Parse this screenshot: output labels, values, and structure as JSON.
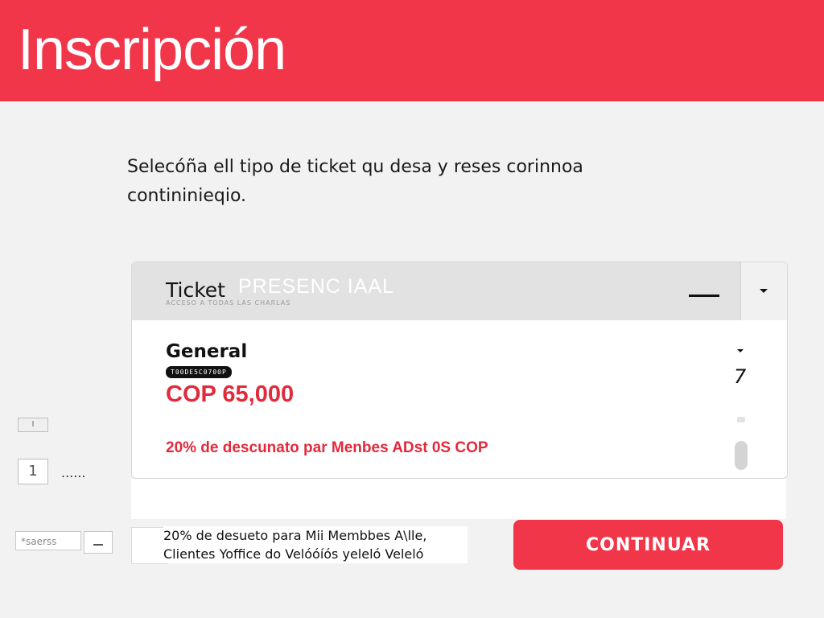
{
  "header": {
    "title": "Inscripción"
  },
  "instructions": {
    "line1": "Selecóña ell tipo de ticket qu desa y reses corinnoa",
    "line2": "contininieqio."
  },
  "ticket_selector": {
    "label": "Ticket",
    "type": "PRESENC IAAL",
    "subtext": "ACCESO A TODAS LAS CHARLAS",
    "dropdown_icon": "caret-down-icon"
  },
  "plan": {
    "name": "General",
    "code": "T00DE5C0700P",
    "price": "COP 65,000",
    "discount": "20% de descunato par Menbes ADst 0S COP",
    "quantity": "7"
  },
  "left_panel": {
    "box1_value": "I",
    "box2_value": "1",
    "dots": "......",
    "search_placeholder": "*saerss"
  },
  "footer": {
    "note_line1": "20% de desueto para Mii Membbes A\\lle,",
    "note_line2": "Clientes Yoffice do Velóóíós yeleló Veleló",
    "continue_label": "CONTINUAR"
  },
  "colors": {
    "brand_red": "#f2364a",
    "price_red": "#e12a3c"
  }
}
